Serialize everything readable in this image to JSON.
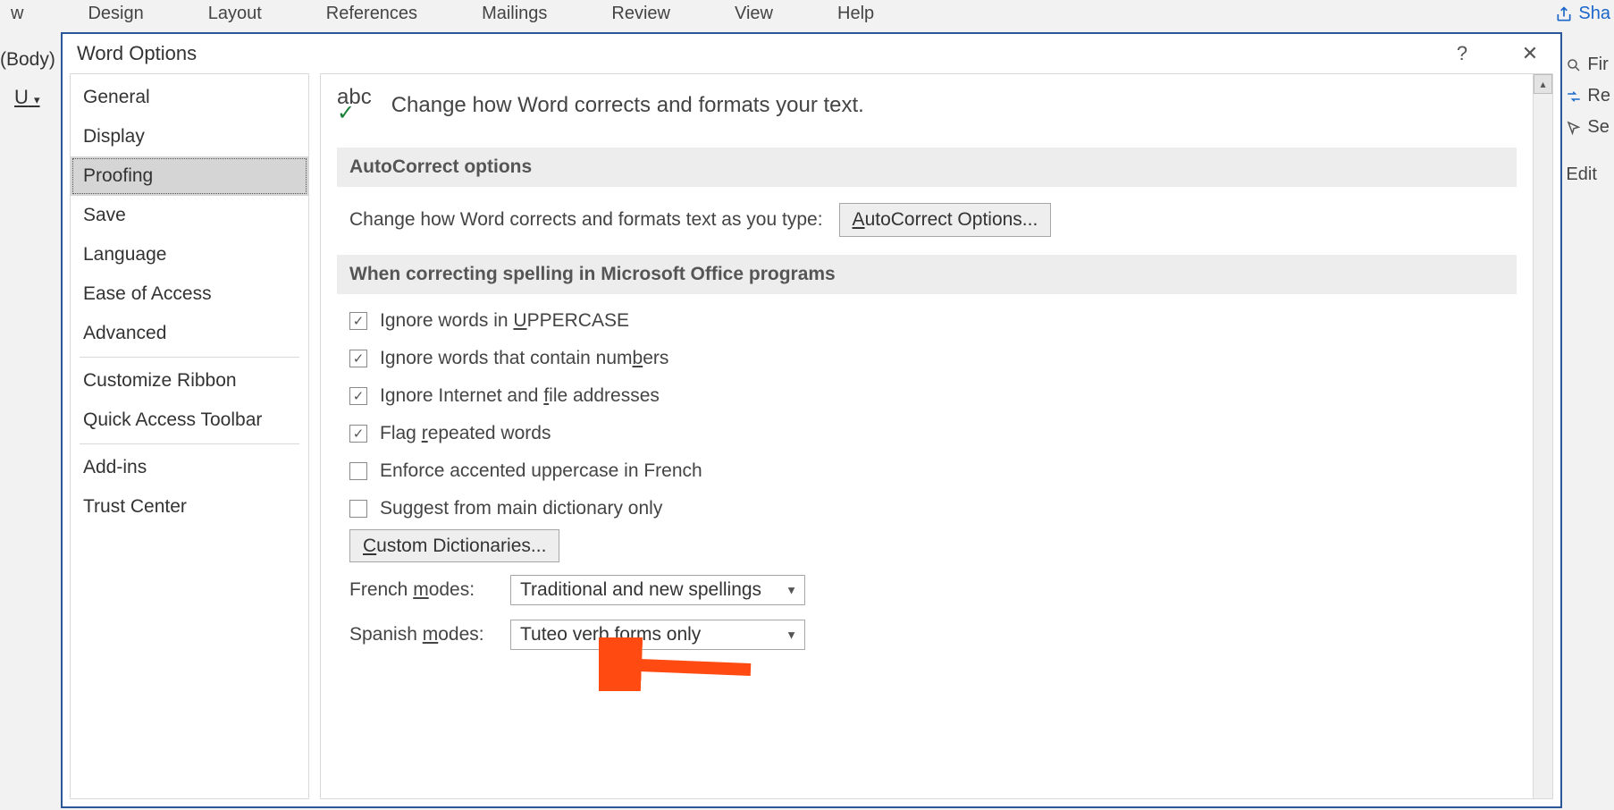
{
  "ribbon": {
    "menus": [
      "w",
      "Design",
      "Layout",
      "References",
      "Mailings",
      "Review",
      "View",
      "Help"
    ]
  },
  "share_label": "Sha",
  "right_frags": [
    "Fir",
    "Re",
    "Se",
    "Edit"
  ],
  "body_frag": "(Body)",
  "underline_frag": "U",
  "dialog": {
    "title": "Word Options",
    "help_glyph": "?",
    "close_glyph": "✕",
    "sidebar": {
      "items": [
        "General",
        "Display",
        "Proofing",
        "Save",
        "Language",
        "Ease of Access",
        "Advanced"
      ],
      "items2": [
        "Customize Ribbon",
        "Quick Access Toolbar"
      ],
      "items3": [
        "Add-ins",
        "Trust Center"
      ],
      "selected_index": 2
    },
    "header_icon_abc": "abc",
    "header_text": "Change how Word corrects and formats your text.",
    "section_autocorrect": "AutoCorrect options",
    "autocorrect_desc": "Change how Word corrects and formats text as you type:",
    "autocorrect_btn_prefix": "A",
    "autocorrect_btn_rest": "utoCorrect Options...",
    "section_spelling": "When correcting spelling in Microsoft Office programs",
    "checks": [
      {
        "checked": true,
        "pre": "Ignore words in ",
        "u": "U",
        "post": "PPERCASE"
      },
      {
        "checked": true,
        "pre": "Ignore words that contain num",
        "u": "b",
        "post": "ers"
      },
      {
        "checked": true,
        "pre": "Ignore Internet and ",
        "u": "f",
        "post": "ile addresses"
      },
      {
        "checked": true,
        "pre": "Flag ",
        "u": "r",
        "post": "epeated words"
      },
      {
        "checked": false,
        "pre": "Enforce accented uppercase in French",
        "u": "",
        "post": ""
      },
      {
        "checked": false,
        "pre": "Suggest from main dictionary only",
        "u": "",
        "post": ""
      }
    ],
    "custom_dict_u": "C",
    "custom_dict_rest": "ustom Dictionaries...",
    "french_label_pre": "French ",
    "french_label_u": "m",
    "french_label_post": "odes:",
    "french_value": "Traditional and new spellings",
    "spanish_label_pre": "Spanish ",
    "spanish_label_u": "m",
    "spanish_label_post": "odes:",
    "spanish_value": "Tuteo verb forms only",
    "scroll_up_glyph": "▴"
  }
}
